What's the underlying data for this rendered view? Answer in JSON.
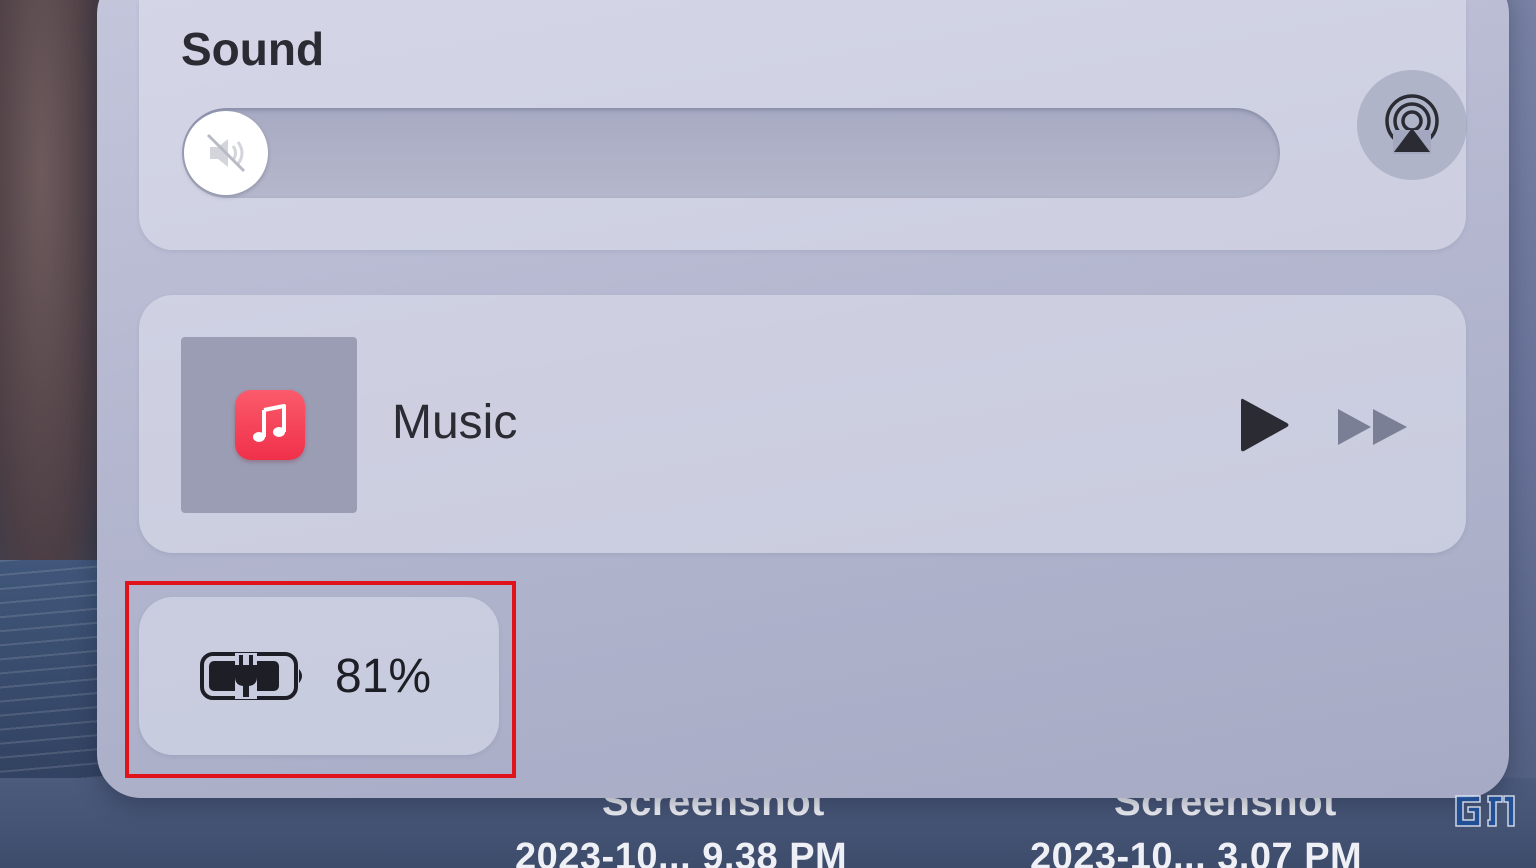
{
  "control_center": {
    "sound": {
      "title": "Sound",
      "volume_level": 0,
      "muted": true,
      "airplay_icon": "airplay-audio-icon"
    },
    "now_playing": {
      "app_name": "Music",
      "app_icon": "music-note-icon",
      "play_icon": "play-icon",
      "forward_icon": "fast-forward-icon"
    },
    "battery": {
      "percent_label": "81%",
      "level": 0.81,
      "charging": true,
      "icon": "battery-charging-icon"
    }
  },
  "desktop": {
    "files": [
      {
        "name": "Screenshot",
        "detail": "2023-10... 9.38 PM"
      },
      {
        "name": "Screenshot",
        "detail": "2023-10... 3.07 PM"
      }
    ]
  },
  "colors": {
    "highlight": "#e0131b",
    "music_icon": "#f0304a",
    "panel": "#b4b7cf"
  }
}
